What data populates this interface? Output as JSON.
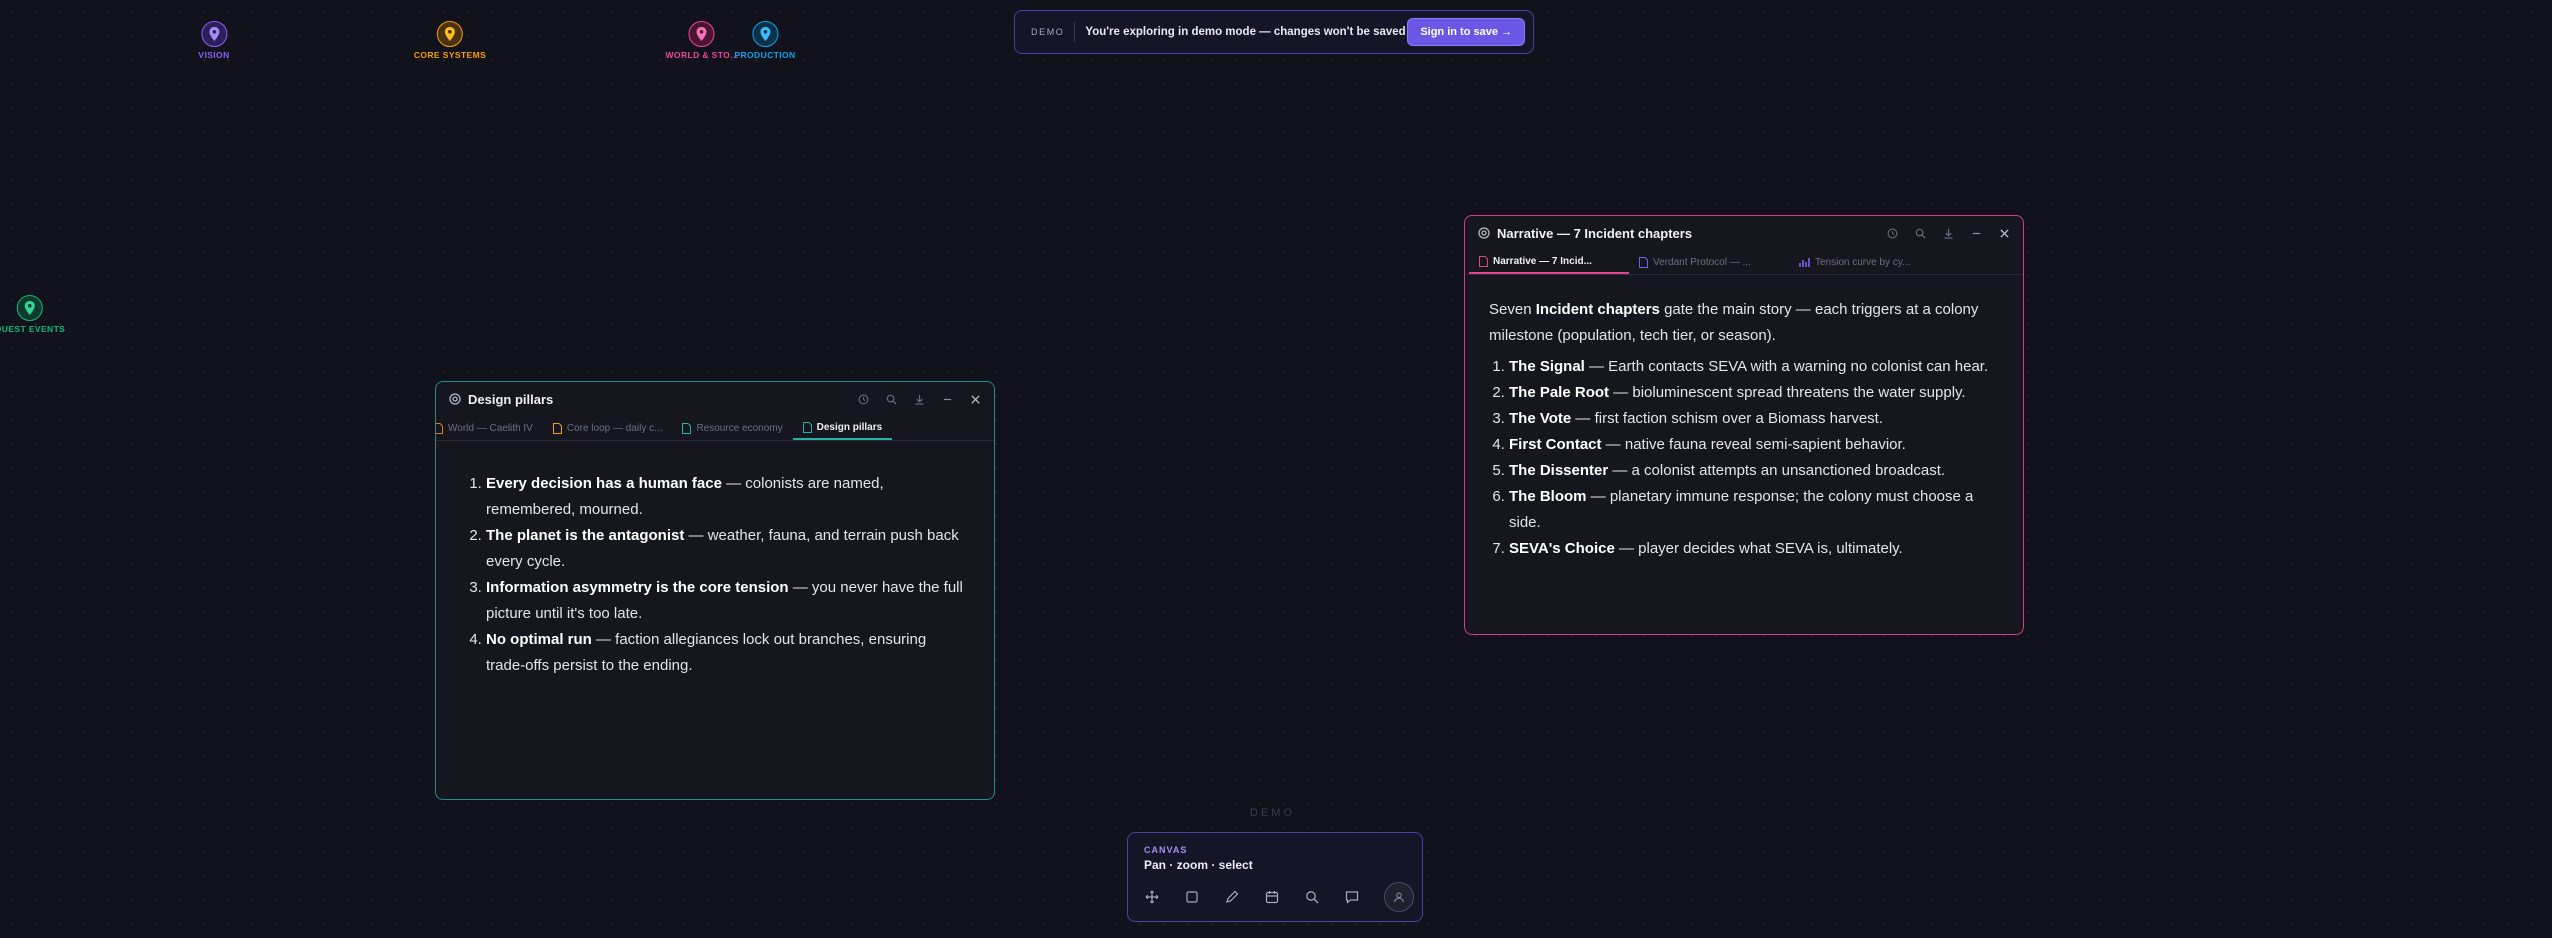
{
  "pins": [
    {
      "label": "VISION",
      "color": "#8b5cf6"
    },
    {
      "label": "CORE SYSTEMS",
      "color": "#f59e0b"
    },
    {
      "label": "WORLD & STO...",
      "color": "#ec4899"
    },
    {
      "label": "PRODUCTION",
      "color": "#0ea5e9"
    },
    {
      "label": "QUEST EVENTS",
      "color": "#10b981"
    }
  ],
  "banner": {
    "tag": "DEMO",
    "message": "You're exploring in demo mode — changes won't be saved",
    "button": "Sign in to save →"
  },
  "pillars_window": {
    "title": "Design pillars",
    "tabs": [
      "World — Caelith IV",
      "Core loop — daily c...",
      "Resource economy",
      "Design pillars"
    ],
    "items": [
      {
        "bold": "Every decision has a human face",
        "text": " — colonists are named, remembered, mourned."
      },
      {
        "bold": "The planet is the antagonist",
        "text": " — weather, fauna, and terrain push back every cycle."
      },
      {
        "bold": "Information asymmetry is the core tension",
        "text": " — you never have the full picture until it's too late."
      },
      {
        "bold": "No optimal run",
        "text": " — faction allegiances lock out branches, ensuring trade-offs persist to the ending."
      }
    ]
  },
  "narrative_window": {
    "title": "Narrative — 7 Incident chapters",
    "tabs": [
      "Narrative — 7 Incid...",
      "Verdant Protocol — ...",
      "Tension curve by cy..."
    ],
    "intro_pre": "Seven ",
    "intro_bold": "Incident chapters",
    "intro_post": " gate the main story — each triggers at a colony milestone (population, tech tier, or season).",
    "items": [
      {
        "bold": "The Signal",
        "text": " — Earth contacts SEVA with a warning no colonist can hear."
      },
      {
        "bold": "The Pale Root",
        "text": " — bioluminescent spread threatens the water supply."
      },
      {
        "bold": "The Vote",
        "text": " — first faction schism over a Biomass harvest."
      },
      {
        "bold": "First Contact",
        "text": " — native fauna reveal semi-sapient behavior."
      },
      {
        "bold": "The Dissenter",
        "text": " — a colonist attempts an unsanctioned broadcast."
      },
      {
        "bold": "The Bloom",
        "text": " — planetary immune response; the colony must choose a side."
      },
      {
        "bold": "SEVA's Choice",
        "text": " — player decides what SEVA is, ultimately."
      }
    ]
  },
  "demo_watermark": "DEMO",
  "dock": {
    "caption": "CANVAS",
    "subtitle": "Pan · zoom · select"
  }
}
